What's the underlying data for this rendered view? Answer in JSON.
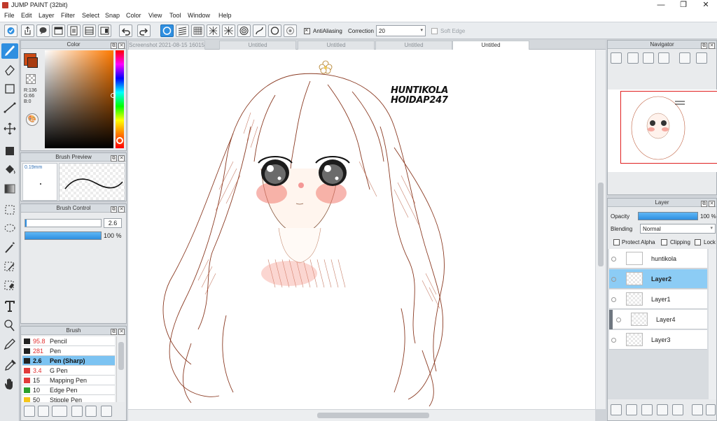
{
  "app": {
    "title": "JUMP PAINT (32bit)",
    "window_controls": {
      "minimize": "—",
      "maximize": "❐",
      "close": "✕"
    }
  },
  "menu": [
    "File",
    "Edit",
    "Layer",
    "Filter",
    "Select",
    "Snap",
    "Color",
    "View",
    "Tool",
    "Window",
    "Help"
  ],
  "toolbar": {
    "antialiasing_label": "AntiAliasing",
    "antialiasing_checked": true,
    "correction_label": "Correction",
    "correction_value": "20",
    "soft_edge_label": "Soft Edge",
    "soft_edge_checked": false
  },
  "color_panel": {
    "title": "Color",
    "r_label": "R:136",
    "g_label": "G:66",
    "b_label": "B:0",
    "foreground_color": "#a83c10",
    "background_color": "#cc4a14"
  },
  "brush_preview": {
    "title": "Brush Preview",
    "size_label": "0.19mm"
  },
  "brush_control": {
    "title": "Brush Control",
    "size_value": "2.6",
    "opacity_value": "100 %",
    "opacity_fraction": 1.0
  },
  "brush_panel": {
    "title": "Brush",
    "items": [
      {
        "size": "95.8",
        "name": "Pencil",
        "color": "#222222",
        "selected": false
      },
      {
        "size": "281",
        "name": "Pen",
        "color": "#222222",
        "selected": false
      },
      {
        "size": "2.6",
        "name": "Pen (Sharp)",
        "color": "#222222",
        "selected": true
      },
      {
        "size": "3.4",
        "name": "G Pen",
        "color": "#e23b3b",
        "selected": false
      },
      {
        "size": "15",
        "name": "Mapping Pen",
        "color": "#e23b3b",
        "selected": false
      },
      {
        "size": "10",
        "name": "Edge Pen",
        "color": "#2ca02c",
        "selected": false
      },
      {
        "size": "50",
        "name": "Stipple Pen",
        "color": "#f5c518",
        "selected": false
      }
    ]
  },
  "tabs": [
    {
      "label": "Screenshot 2021-08-15 160154.png",
      "active": false
    },
    {
      "label": "Untitled",
      "active": false
    },
    {
      "label": "Untitled",
      "active": false
    },
    {
      "label": "Untitled",
      "active": false
    },
    {
      "label": "Untitled",
      "active": true
    }
  ],
  "canvas": {
    "signature_line1": "HUNTIKOLA",
    "signature_line2": "HOIDAP247"
  },
  "navigator": {
    "title": "Navigator"
  },
  "layer_panel": {
    "title": "Layer",
    "opacity_label": "Opacity",
    "opacity_value": "100 %",
    "opacity_fraction": 1.0,
    "blending_label": "Blending",
    "blending_value": "Normal",
    "protect_alpha_label": "Protect Alpha",
    "clipping_label": "Clipping",
    "lock_label": "Lock",
    "layers": [
      {
        "name": "huntikola",
        "selected": false,
        "indent": false
      },
      {
        "name": "Layer2",
        "selected": true,
        "indent": false
      },
      {
        "name": "Layer1",
        "selected": false,
        "indent": false
      },
      {
        "name": "Layer4",
        "selected": false,
        "indent": true
      },
      {
        "name": "Layer3",
        "selected": false,
        "indent": false
      }
    ]
  }
}
